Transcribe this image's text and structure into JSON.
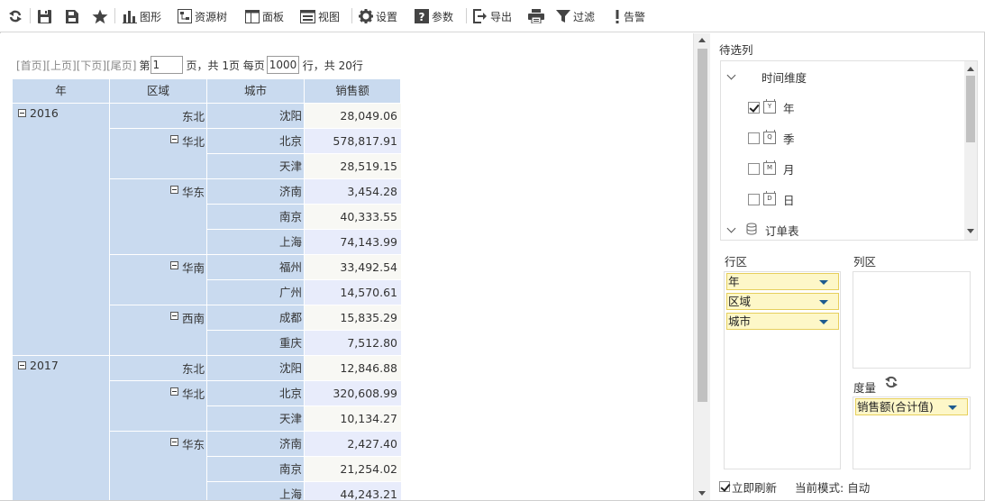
{
  "toolbar": {
    "chart": "图形",
    "resource_tree": "资源树",
    "panel": "面板",
    "view": "视图",
    "settings": "设置",
    "params": "参数",
    "export": "导出",
    "filter": "过滤",
    "alert": "告警"
  },
  "pager": {
    "first": "[首页]",
    "prev": "[上页]",
    "next": "[下页]",
    "last": "[尾页]",
    "page_prefix": "第",
    "page_value": "1",
    "page_suffix": "页，共 1页 每页",
    "rows_per_page": "1000",
    "rows_suffix": "行，共 20行"
  },
  "table": {
    "headers": [
      "年",
      "区域",
      "城市",
      "销售额"
    ],
    "years": [
      {
        "year": "2016",
        "regions": [
          {
            "name": "东北",
            "collapsible": false,
            "cities": [
              {
                "city": "沈阳",
                "sales": "28,049.06"
              }
            ]
          },
          {
            "name": "华北",
            "collapsible": true,
            "cities": [
              {
                "city": "北京",
                "sales": "578,817.91"
              },
              {
                "city": "天津",
                "sales": "28,519.15"
              }
            ]
          },
          {
            "name": "华东",
            "collapsible": true,
            "cities": [
              {
                "city": "济南",
                "sales": "3,454.28"
              },
              {
                "city": "南京",
                "sales": "40,333.55"
              },
              {
                "city": "上海",
                "sales": "74,143.99"
              }
            ]
          },
          {
            "name": "华南",
            "collapsible": true,
            "cities": [
              {
                "city": "福州",
                "sales": "33,492.54"
              },
              {
                "city": "广州",
                "sales": "14,570.61"
              }
            ]
          },
          {
            "name": "西南",
            "collapsible": true,
            "cities": [
              {
                "city": "成都",
                "sales": "15,835.29"
              },
              {
                "city": "重庆",
                "sales": "7,512.80"
              }
            ]
          }
        ]
      },
      {
        "year": "2017",
        "regions": [
          {
            "name": "东北",
            "collapsible": false,
            "cities": [
              {
                "city": "沈阳",
                "sales": "12,846.88"
              }
            ]
          },
          {
            "name": "华北",
            "collapsible": true,
            "cities": [
              {
                "city": "北京",
                "sales": "320,608.99"
              },
              {
                "city": "天津",
                "sales": "10,134.27"
              }
            ]
          },
          {
            "name": "华东",
            "collapsible": true,
            "cities": [
              {
                "city": "济南",
                "sales": "2,427.40"
              },
              {
                "city": "南京",
                "sales": "21,254.02"
              },
              {
                "city": "上海",
                "sales": "44,243.21"
              }
            ]
          }
        ]
      }
    ]
  },
  "panel": {
    "candidates_title": "待选列",
    "tree": [
      {
        "label": "时间维度",
        "kind": "group",
        "checked": false
      },
      {
        "label": "年",
        "kind": "dim",
        "icon_letter": "Y",
        "checked": true
      },
      {
        "label": "季",
        "kind": "dim",
        "icon_letter": "Q",
        "checked": false
      },
      {
        "label": "月",
        "kind": "dim",
        "icon_letter": "M",
        "checked": false
      },
      {
        "label": "日",
        "kind": "dim",
        "icon_letter": "D",
        "checked": false
      },
      {
        "label": "订单表",
        "kind": "table",
        "checked": false
      }
    ],
    "row_zone_title": "行区",
    "col_zone_title": "列区",
    "row_fields": [
      "年",
      "区域",
      "城市"
    ],
    "measure_title": "度量",
    "measure_fields": [
      "销售额(合计值)"
    ],
    "auto_refresh_label": "立即刷新",
    "auto_refresh_checked": true,
    "mode_label": "当前模式: 自动"
  },
  "colors": {
    "header_bg": "#c9daef",
    "value_bg_odd": "#f8f8f4",
    "value_bg_even": "#e8ecfb",
    "field_bg": "#fdf7c8",
    "field_border": "#e6cf5c"
  }
}
